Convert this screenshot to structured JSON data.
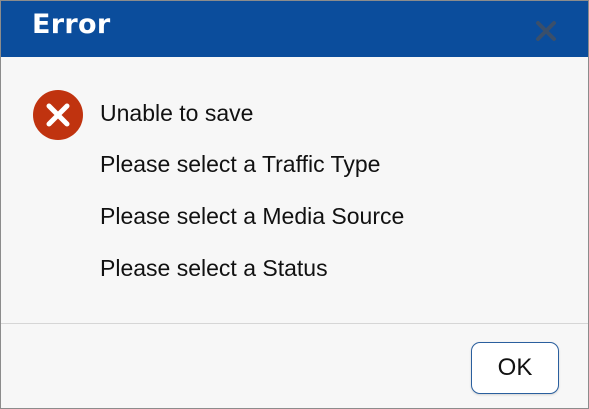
{
  "dialog": {
    "title": "Error",
    "close_icon": "close-icon",
    "status_icon": "error-circle-x-icon",
    "messages": [
      "Unable to save",
      "Please select a Traffic Type",
      "Please select a Media Source",
      "Please select a Status"
    ],
    "ok_label": "OK"
  },
  "colors": {
    "titlebar": "#0b4d9c",
    "error_icon": "#c0330f",
    "body_background": "#f7f7f7"
  }
}
